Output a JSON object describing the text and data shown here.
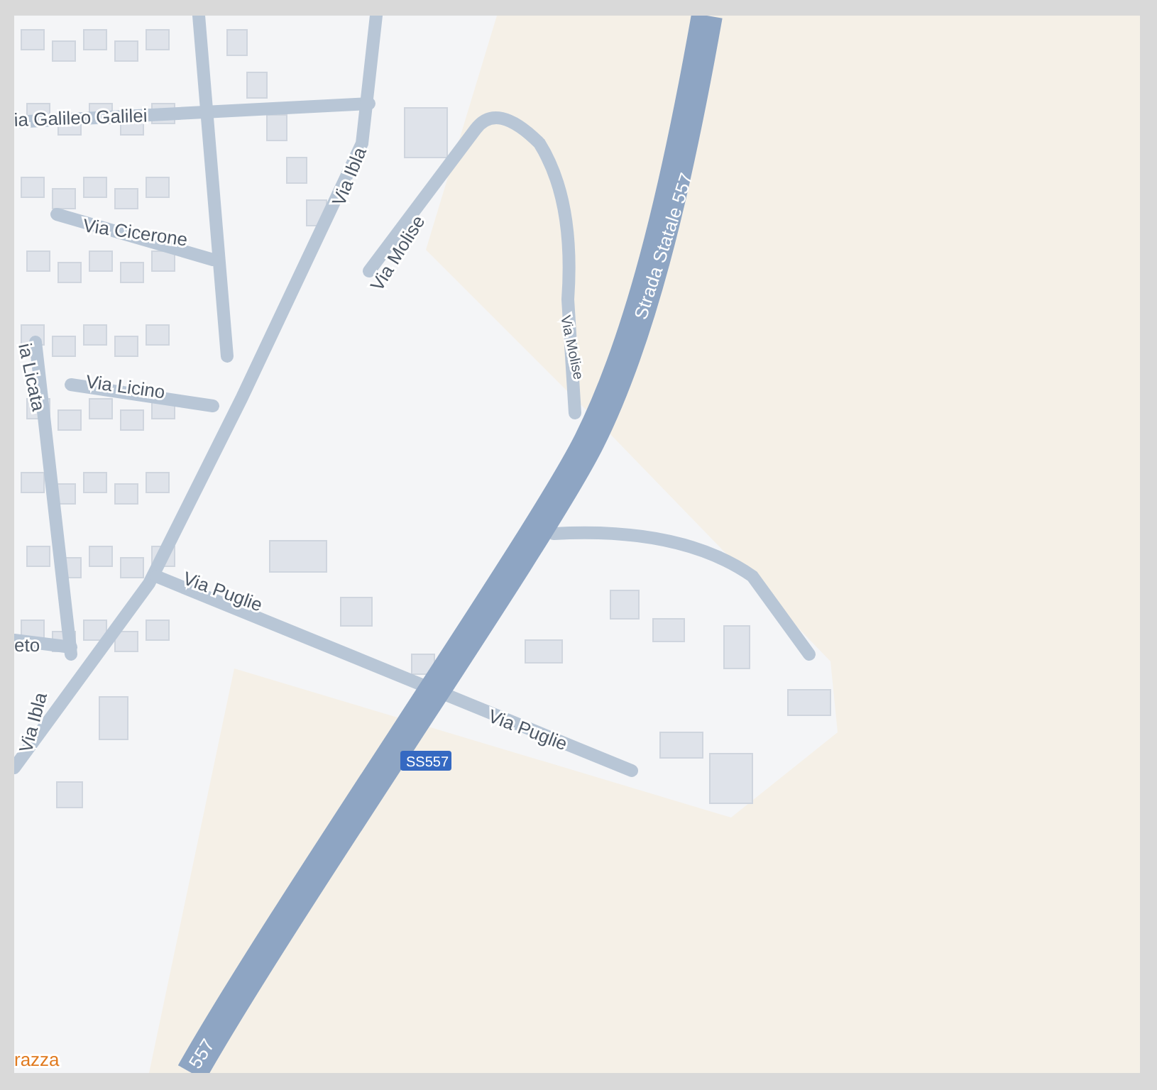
{
  "map": {
    "labels": [
      {
        "text": "ia Galileo Galilei",
        "kind": "street"
      },
      {
        "text": "Via Ibla",
        "kind": "street"
      },
      {
        "text": "Via Cicerone",
        "kind": "street"
      },
      {
        "text": "Via Molise",
        "kind": "street"
      },
      {
        "text": "Strada Statale 557",
        "kind": "highway"
      },
      {
        "text": "Via Molise",
        "kind": "small"
      },
      {
        "text": "ia Licata",
        "kind": "street"
      },
      {
        "text": "Via Licino",
        "kind": "street"
      },
      {
        "text": "Via Puglie",
        "kind": "street"
      },
      {
        "text": "eto",
        "kind": "street"
      },
      {
        "text": "Via Ibla",
        "kind": "street"
      },
      {
        "text": "Via Puglie",
        "kind": "street"
      },
      {
        "text": "SS557",
        "kind": "shield"
      },
      {
        "text": "557",
        "kind": "highway"
      },
      {
        "text": "razza",
        "kind": "place"
      }
    ]
  }
}
